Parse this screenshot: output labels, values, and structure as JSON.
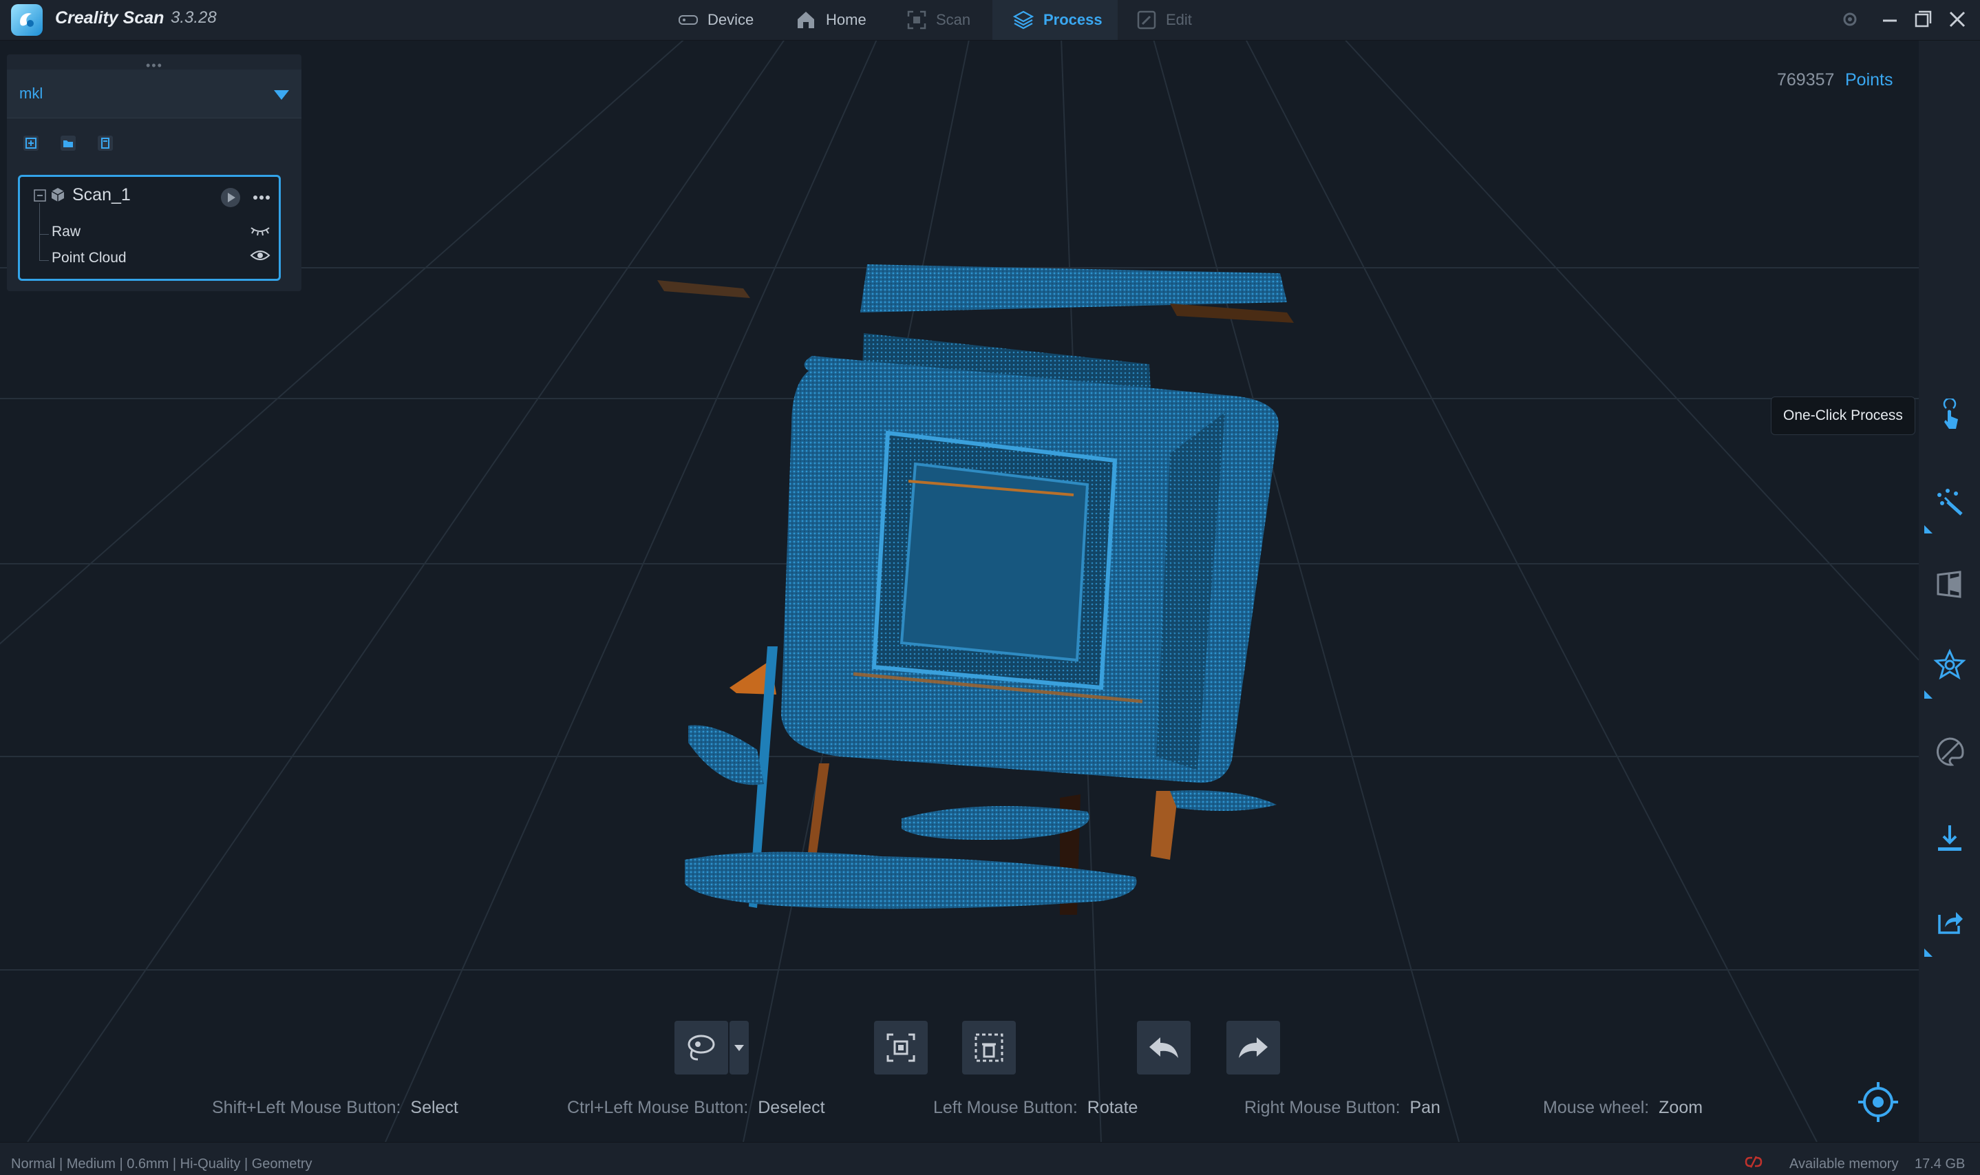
{
  "app": {
    "title": "Creality Scan",
    "version": "3.3.28"
  },
  "nav": {
    "tabs": [
      {
        "label": "Device",
        "state": "normal"
      },
      {
        "label": "Home",
        "state": "normal"
      },
      {
        "label": "Scan",
        "state": "disabled"
      },
      {
        "label": "Process",
        "state": "active"
      },
      {
        "label": "Edit",
        "state": "disabled"
      }
    ]
  },
  "viewport": {
    "points_count": "769357",
    "points_label": "Points"
  },
  "project_panel": {
    "project_name": "mkl",
    "scan": {
      "name": "Scan_1",
      "children": [
        {
          "label": "Raw",
          "visibility": "hidden"
        },
        {
          "label": "Point Cloud",
          "visibility": "visible"
        }
      ]
    }
  },
  "right_toolbar": {
    "tooltip": "One-Click Process",
    "icons": [
      "one-click-process-icon",
      "point-cloud-process-icon",
      "mesh-icon",
      "texture-icon",
      "color-icon",
      "export-icon",
      "share-icon"
    ]
  },
  "mouse_hints": [
    {
      "key": "Shift+Left Mouse Button:",
      "action": "Select"
    },
    {
      "key": "Ctrl+Left Mouse Button:",
      "action": "Deselect"
    },
    {
      "key": "Left Mouse Button:",
      "action": "Rotate"
    },
    {
      "key": "Right Mouse Button:",
      "action": "Pan"
    },
    {
      "key": "Mouse wheel:",
      "action": "Zoom"
    }
  ],
  "status": {
    "settings": "Normal | Medium | 0.6mm | Hi-Quality | Geometry",
    "memory_label": "Available memory",
    "memory_value": "17.4 GB"
  },
  "colors": {
    "accent": "#3aa8f2",
    "cloud_blue": "#1f7fb8",
    "cloud_orange": "#c76a1e"
  }
}
